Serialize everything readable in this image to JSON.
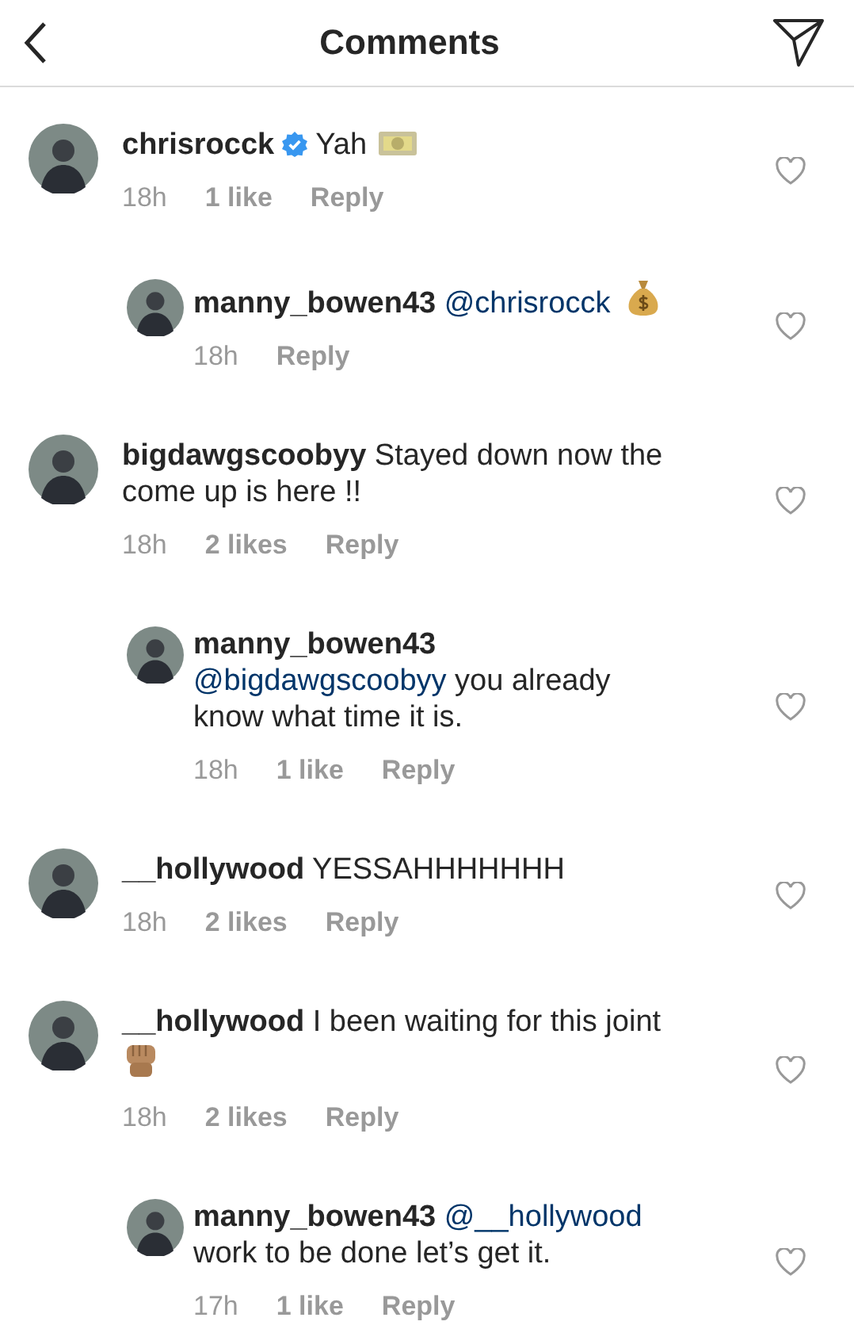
{
  "header": {
    "title": "Comments"
  },
  "comments": [
    {
      "is_reply": false,
      "user": "chrisrocck",
      "verified": true,
      "text": "Yah",
      "emoji": {
        "kind": "banknote"
      },
      "time": "18h",
      "likes": "1 like",
      "reply_label": "Reply"
    },
    {
      "is_reply": true,
      "user": "manny_bowen43",
      "verified": false,
      "mention": "@chrisrocck",
      "emoji": {
        "kind": "money_bag"
      },
      "time": "18h",
      "reply_label": "Reply"
    },
    {
      "is_reply": false,
      "user": "bigdawgscoobyy",
      "verified": false,
      "text": "Stayed down now the come up is here !!",
      "time": "18h",
      "likes": "2 likes",
      "reply_label": "Reply"
    },
    {
      "is_reply": true,
      "user": "manny_bowen43",
      "verified": false,
      "mention": "@bigdawgscoobyy",
      "text": "you already know what time it is.",
      "time": "18h",
      "likes": "1 like",
      "reply_label": "Reply"
    },
    {
      "is_reply": false,
      "user": "__hollywood",
      "verified": false,
      "text": "YESSAHHHHHHH",
      "time": "18h",
      "likes": "2 likes",
      "reply_label": "Reply"
    },
    {
      "is_reply": false,
      "user": "__hollywood",
      "verified": false,
      "text": "I been waiting for this joint",
      "emoji": {
        "kind": "fist"
      },
      "time": "18h",
      "likes": "2 likes",
      "reply_label": "Reply"
    },
    {
      "is_reply": true,
      "user": "manny_bowen43",
      "verified": false,
      "mention": "@__hollywood",
      "text": "work to be done let’s get it.",
      "time": "17h",
      "likes": "1 like",
      "reply_label": "Reply"
    }
  ]
}
